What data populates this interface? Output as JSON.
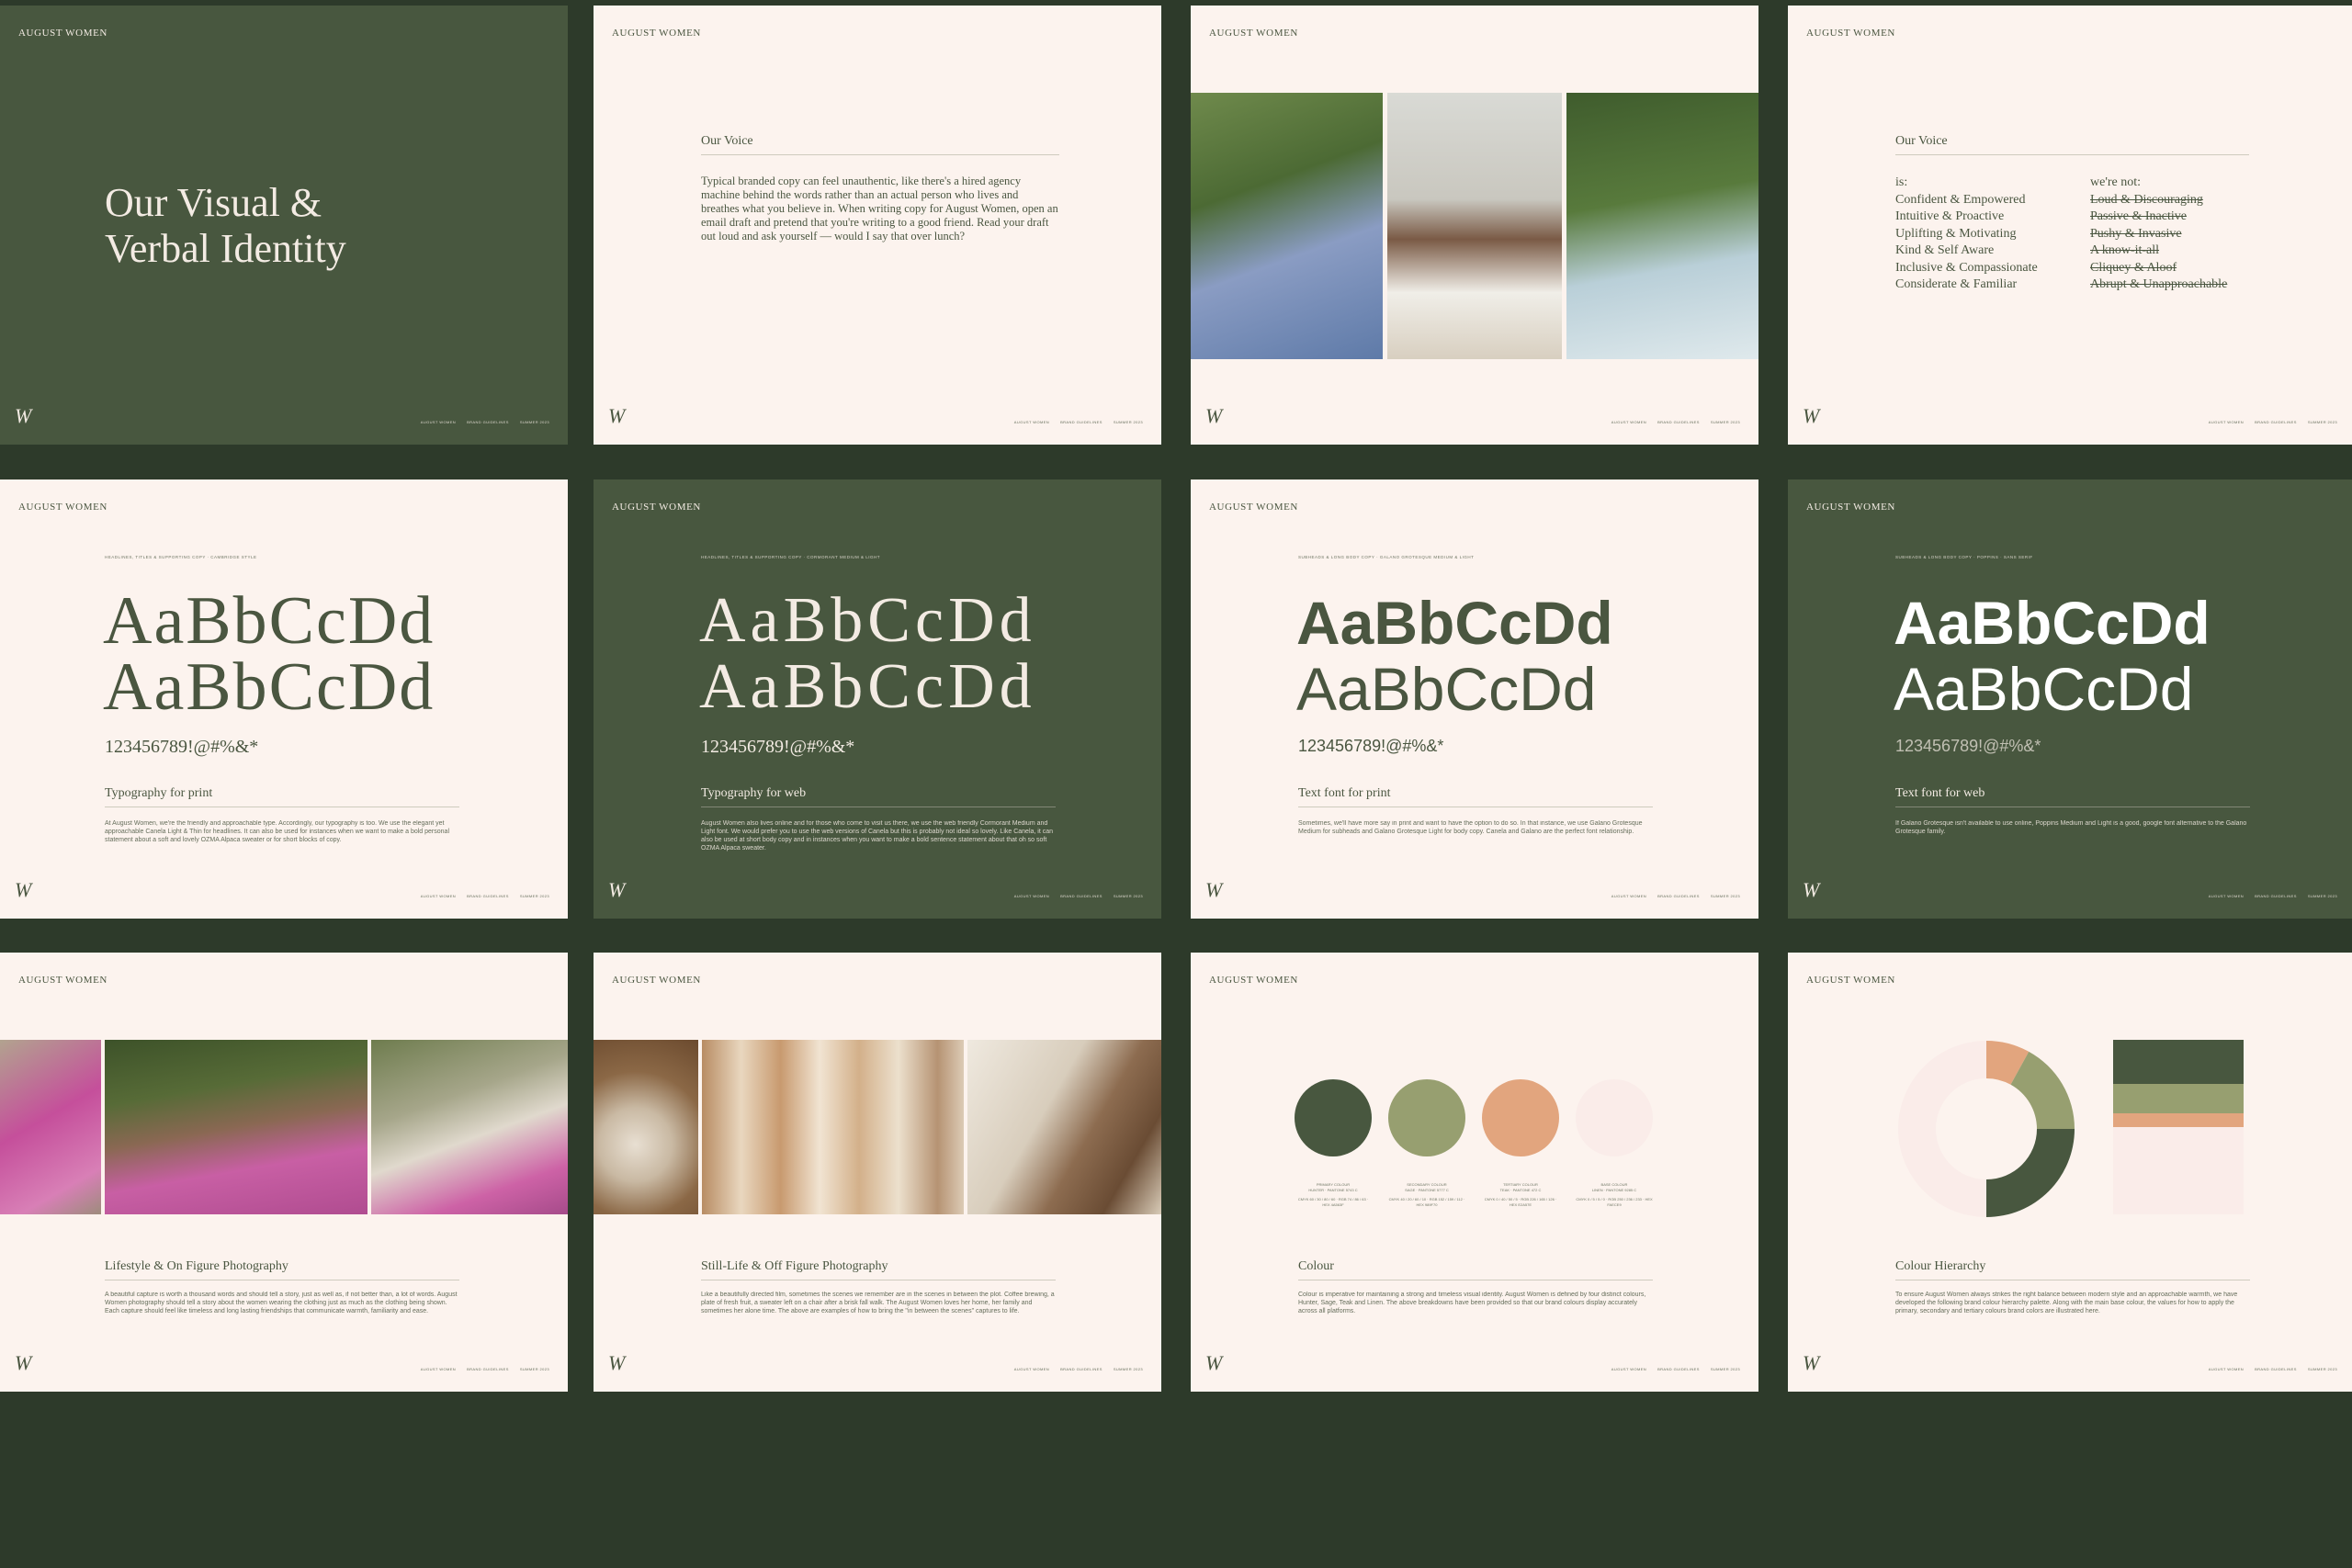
{
  "brand": "AUGUST WOMEN",
  "logo_text": "W",
  "footer": [
    "AUGUST WOMEN",
    "BRAND GUIDELINES",
    "SUMMER 2023"
  ],
  "slide1": {
    "title_line1": "Our Visual &",
    "title_line2": "Verbal Identity"
  },
  "slide2": {
    "heading": "Our Voice",
    "body": "Typical branded copy can feel unauthentic, like there's a hired agency machine behind the words rather than an actual person who lives and breathes what you believe in. When writing copy for August Women, open an email draft and pretend that you're writing to a good friend. Read your draft out loud and ask yourself — would I say that over lunch?"
  },
  "slide4": {
    "heading": "Our Voice",
    "is_label": "is:",
    "is_items": [
      "Confident & Empowered",
      "Intuitive & Proactive",
      "Uplifting & Motivating",
      "Kind & Self Aware",
      "Inclusive & Compassionate",
      "Considerate & Familiar"
    ],
    "not_label": "we're not:",
    "not_items": [
      "Loud & Discouraging",
      "Passive & Inactive",
      "Pushy & Invasive",
      "A know-it-all",
      "Cliquey & Aloof",
      "Abrupt & Unapproachable"
    ]
  },
  "type_print": {
    "eyebrow": "HEADLINES, TITLES & SUPPORTING COPY · CAMBRIDGE STYLE",
    "spec1": "AaBbCcDd",
    "spec2": "AaBbCcDd",
    "numerals": "123456789!@#%&*",
    "heading": "Typography for print",
    "body": "At August Women, we're the friendly and approachable type. Accordingly, our typography is too. We use the elegant yet approachable Canela Light & Thin for headlines. It can also be used for instances when we want to make a bold personal statement about a soft and lovely OZMA Alpaca sweater or for short blocks of copy."
  },
  "type_web": {
    "eyebrow": "HEADLINES, TITLES & SUPPORTING COPY · CORMORANT MEDIUM & LIGHT",
    "spec1": "AaBbCcDd",
    "spec2": "AaBbCcDd",
    "numerals": "123456789!@#%&*",
    "heading": "Typography for web",
    "body": "August Women also lives online and for those who come to visit us there, we use the web friendly Cormorant Medium and Light font. We would prefer you to use the web versions of Canela but this is probably not ideal so lovely. Like Canela, it can also be used at short body copy and in instances when you want to make a bold sentence statement about that oh so soft OZMA Alpaca sweater."
  },
  "text_print": {
    "eyebrow": "SUBHEADS & LONG BODY COPY · GALANO GROTESQUE MEDIUM & LIGHT",
    "spec1": "AaBbCcDd",
    "spec2": "AaBbCcDd",
    "numerals": "123456789!@#%&*",
    "heading": "Text font for print",
    "body": "Sometimes, we'll have more say in print and want to have the option to do so. In that instance, we use Galano Grotesque Medium for subheads and Galano Grotesque Light for body copy. Canela and Galano are the perfect font relationship."
  },
  "text_web": {
    "eyebrow": "SUBHEADS & LONG BODY COPY · POPPINS · SANS SERIF",
    "spec1": "AaBbCcDd",
    "spec2": "AaBbCcDd",
    "numerals": "123456789!@#%&*",
    "heading": "Text font for web",
    "body": "If Galano Grotesque isn't available to use online, Poppins Medium and Light is a good, google font alternative to the Galano Grotesque family."
  },
  "lifestyle": {
    "heading": "Lifestyle & On Figure Photography",
    "body": "A beautiful capture is worth a thousand words and should tell a story, just as well as, if not better than, a lot of words. August Women photography should tell a story about the women wearing the clothing just as much as the clothing being shown. Each capture should feel like timeless and long lasting friendships that communicate warmth, familiarity and ease."
  },
  "stilllife": {
    "heading": "Still-Life & Off Figure Photography",
    "body": "Like a beautifully directed film, sometimes the scenes we remember are in the scenes in between the plot. Coffee brewing, a plate of fresh fruit, a sweater left on a chair after a brisk fall walk. The August Women loves her home, her family and sometimes her alone time. The above are examples of how to bring the \"in between the scenes\" captures to life."
  },
  "colour": {
    "heading": "Colour",
    "body": "Colour is imperative for maintaining a strong and timeless visual identity. August Women is defined by four distinct colours, Hunter, Sage, Teak and Linen. The above breakdowns have been provided so that our brand colours display accurately across all platforms.",
    "swatches": [
      {
        "name": "PRIMARY COLOUR",
        "sub": "HUNTER · PANTONE 5743 C",
        "values": "CMYK 60 / 30 / 80 / 60 · RGB 74 / 86 / 63 · HEX 4A563F",
        "hex": "#48573f"
      },
      {
        "name": "SECONDARY COLOUR",
        "sub": "SAGE · PANTONE 5777 C",
        "values": "CMYK 40 / 20 / 60 / 10 · RGB 152 / 159 / 112 · HEX 989F70",
        "hex": "#979f70"
      },
      {
        "name": "TERTIARY COLOUR",
        "sub": "TEAK · PANTONE 472 C",
        "values": "CMYK 0 / 40 / 50 / 5 · RGB 226 / 165 / 126 · HEX E2A57E",
        "hex": "#e2a57e"
      },
      {
        "name": "BASE COLOUR",
        "sub": "LINEN · PANTONE 9285 C",
        "values": "CMYK 0 / 5 / 5 / 0 · RGB 250 / 236 / 233 · HEX FAECE9",
        "hex": "#faece9"
      }
    ]
  },
  "hierarchy": {
    "heading": "Colour Hierarchy",
    "body": "To ensure August Women always strikes the right balance between modern style and an approachable warmth, we have developed the following brand colour hierarchy palette. Along with the main base colour, the values for how to apply the primary, secondary and tertiary colours brand colors are illustrated here."
  },
  "chart_data": {
    "type": "pie",
    "categories": [
      "Linen",
      "Hunter",
      "Sage",
      "Teak"
    ],
    "values": [
      50,
      25,
      17,
      8
    ],
    "colors": [
      "#faece9",
      "#48573f",
      "#979f70",
      "#e2a57e"
    ],
    "title": "",
    "legend": "none"
  }
}
